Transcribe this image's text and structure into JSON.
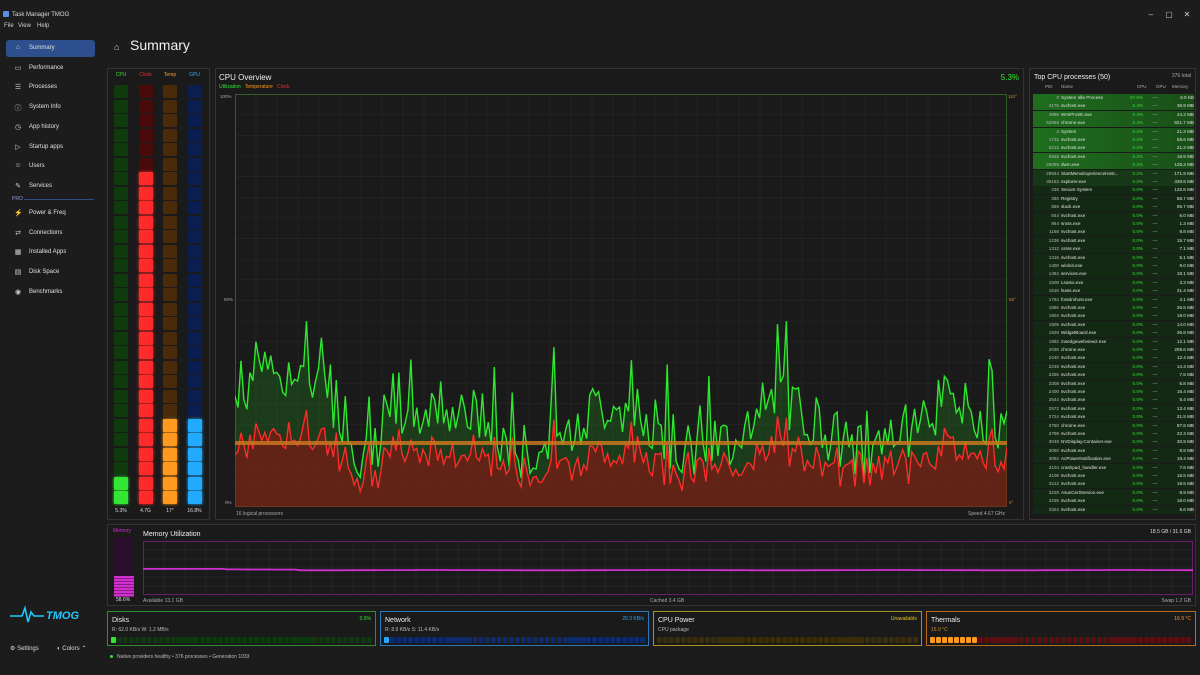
{
  "window": {
    "title": "Task Manager TMOG",
    "minimize": "–",
    "maximize": "▢",
    "close": "✕"
  },
  "menu": [
    "File",
    "View",
    "Help"
  ],
  "sidebar": {
    "items": [
      {
        "label": "Summary",
        "icon": "⌂",
        "active": true
      },
      {
        "label": "Performance",
        "icon": "▭"
      },
      {
        "label": "Processes",
        "icon": "☰"
      },
      {
        "label": "System Info",
        "icon": "ⓘ"
      },
      {
        "label": "App history",
        "icon": "◷"
      },
      {
        "label": "Startup apps",
        "icon": "▷"
      },
      {
        "label": "Users",
        "icon": "☺"
      },
      {
        "label": "Services",
        "icon": "✎"
      }
    ],
    "pro_label": "PRO",
    "pro_items": [
      {
        "label": "Power & Freq",
        "icon": "⚡"
      },
      {
        "label": "Connections",
        "icon": "⇄"
      },
      {
        "label": "Installed Apps",
        "icon": "▦"
      },
      {
        "label": "Disk Space",
        "icon": "▤"
      },
      {
        "label": "Benchmarks",
        "icon": "◉"
      }
    ],
    "logo_text": "TMOG",
    "settings_label": "Settings",
    "colors_label": "Colors"
  },
  "page": {
    "title": "Summary"
  },
  "bars": [
    {
      "label": "CPU",
      "value": "5.3%",
      "color": "#33e633",
      "level": 0.06
    },
    {
      "label": "Clock",
      "value": "4.7G",
      "color": "#ff2a2a",
      "level": 0.78
    },
    {
      "label": "Temp",
      "value": "17°",
      "color": "#ff9a1f",
      "level": 0.19
    },
    {
      "label": "GPU",
      "value": "16.8%",
      "color": "#22aaff",
      "level": 0.19
    }
  ],
  "cpu_overview": {
    "title": "CPU Overview",
    "percent": "5.3%",
    "legend": [
      "Utilization",
      "Temperature",
      "Clock"
    ],
    "legend_colors": [
      "#2ee82e",
      "#ff9a1f",
      "#ff2a2a"
    ],
    "left_axis": [
      "100%",
      "50%",
      "0%"
    ],
    "right_axis": [
      "110°",
      "55°",
      "0°"
    ],
    "logical": "16 logical processors",
    "speed": "Speed 4.67 GHz"
  },
  "processes": {
    "title": "Top CPU processes (50)",
    "total": "376 total",
    "headers": {
      "pid": "PID",
      "name": "Name",
      "cpu": "CPU",
      "gpu": "GPU",
      "memory": "Memory"
    },
    "rows": [
      [
        "0",
        "System Idle Process",
        "97.5%",
        "—",
        "8.0 KB"
      ],
      [
        "4176",
        "svchost.exe",
        "0.4%",
        "—",
        "36.9 MB"
      ],
      [
        "4996",
        "WmiPrvSE.exe",
        "0.4%",
        "—",
        "44.3 MB"
      ],
      [
        "52656",
        "chrome.exe",
        "0.4%",
        "—",
        "821.7 MB"
      ],
      [
        "4",
        "System",
        "0.2%",
        "—",
        "21.3 MB"
      ],
      [
        "1732",
        "svchost.exe",
        "0.2%",
        "—",
        "58.6 MB"
      ],
      [
        "5212",
        "svchost.exe",
        "0.2%",
        "—",
        "21.2 MB"
      ],
      [
        "6948",
        "svchost.exe",
        "0.2%",
        "—",
        "18.5 MB"
      ],
      [
        "28096",
        "dwm.exe",
        "0.2%",
        "—",
        "125.3 MB"
      ],
      [
        "29944",
        "StartMenuExperienceHost...",
        "0.2%",
        "—",
        "171.9 MB"
      ],
      [
        "36152",
        "explorer.exe",
        "0.2%",
        "—",
        "338.8 MB"
      ],
      [
        "236",
        "Secure System",
        "0.0%",
        "—",
        "132.8 MB"
      ],
      [
        "280",
        "Registry",
        "0.0%",
        "—",
        "56.7 MB"
      ],
      [
        "856",
        "slack.exe",
        "0.0%",
        "—",
        "95.7 MB"
      ],
      [
        "844",
        "svchost.exe",
        "0.0%",
        "—",
        "6.0 MB"
      ],
      [
        "864",
        "smss.exe",
        "0.0%",
        "—",
        "1.3 MB"
      ],
      [
        "1168",
        "svchost.exe",
        "0.0%",
        "—",
        "9.8 MB"
      ],
      [
        "1236",
        "svchost.exe",
        "0.0%",
        "—",
        "15.7 MB"
      ],
      [
        "1312",
        "csrss.exe",
        "0.0%",
        "—",
        "7.1 MB"
      ],
      [
        "1316",
        "svchost.exe",
        "0.0%",
        "—",
        "5.1 MB"
      ],
      [
        "1400",
        "wininit.exe",
        "0.0%",
        "—",
        "9.0 MB"
      ],
      [
        "1484",
        "services.exe",
        "0.0%",
        "—",
        "18.1 MB"
      ],
      [
        "1508",
        "LsaIso.exe",
        "0.0%",
        "—",
        "3.3 MB"
      ],
      [
        "1516",
        "lsass.exe",
        "0.0%",
        "—",
        "31.4 MB"
      ],
      [
        "1764",
        "fontdrvhost.exe",
        "0.0%",
        "—",
        "4.1 MB"
      ],
      [
        "1856",
        "svchost.exe",
        "0.0%",
        "—",
        "25.5 MB"
      ],
      [
        "1904",
        "svchost.exe",
        "0.0%",
        "—",
        "18.0 MB"
      ],
      [
        "1908",
        "svchost.exe",
        "0.0%",
        "—",
        "14.0 MB"
      ],
      [
        "1928",
        "WidgetBoard.exe",
        "0.0%",
        "—",
        "36.8 MB"
      ],
      [
        "1992",
        "msedgewebview2.exe",
        "0.0%",
        "—",
        "12.1 MB"
      ],
      [
        "2036",
        "chrome.exe",
        "0.0%",
        "—",
        "208.6 MB"
      ],
      [
        "2240",
        "svchost.exe",
        "0.0%",
        "—",
        "12.4 MB"
      ],
      [
        "2248",
        "svchost.exe",
        "0.0%",
        "—",
        "14.4 MB"
      ],
      [
        "2256",
        "svchost.exe",
        "0.0%",
        "—",
        "7.5 MB"
      ],
      [
        "2308",
        "svchost.exe",
        "0.0%",
        "—",
        "6.8 MB"
      ],
      [
        "2400",
        "svchost.exe",
        "0.0%",
        "—",
        "16.4 MB"
      ],
      [
        "2544",
        "svchost.exe",
        "0.0%",
        "—",
        "8.4 MB"
      ],
      [
        "2572",
        "svchost.exe",
        "0.0%",
        "—",
        "13.4 MB"
      ],
      [
        "2724",
        "svchost.exe",
        "0.0%",
        "—",
        "21.5 MB"
      ],
      [
        "2760",
        "chrome.exe",
        "0.0%",
        "—",
        "97.8 MB"
      ],
      [
        "2798",
        "svchost.exe",
        "0.0%",
        "—",
        "22.3 MB"
      ],
      [
        "3048",
        "NVDisplay.Container.exe",
        "0.0%",
        "—",
        "30.9 MB"
      ],
      [
        "3060",
        "svchost.exe",
        "0.0%",
        "—",
        "8.8 MB"
      ],
      [
        "3092",
        "AcPowerNotification.exe",
        "0.0%",
        "—",
        "19.4 MB"
      ],
      [
        "3104",
        "crashpad_handler.exe",
        "0.0%",
        "—",
        "7.6 MB"
      ],
      [
        "3108",
        "svchost.exe",
        "0.0%",
        "—",
        "15.5 MB"
      ],
      [
        "3212",
        "svchost.exe",
        "0.0%",
        "—",
        "19.5 MB"
      ],
      [
        "3228",
        "AsusCertService.exe",
        "0.0%",
        "—",
        "8.9 MB"
      ],
      [
        "3236",
        "svchost.exe",
        "0.0%",
        "—",
        "18.0 MB"
      ],
      [
        "3324",
        "svchost.exe",
        "0.0%",
        "—",
        "6.6 MB"
      ]
    ]
  },
  "memory": {
    "label": "Memory",
    "title": "Memory Utilization",
    "percent": "58.6%",
    "total": "18.5 GB / 31.6 GB",
    "available": "Available 13.1 GB",
    "cached": "Cached 3.4 GB",
    "swap": "Swap 1.2 GB",
    "color": "#d02fd0"
  },
  "cards": {
    "disks": {
      "title": "Disks",
      "sub": "R: 62.0 KB/s  W: 1.2 MB/s",
      "right": "0.6%",
      "color": "#2ee82e",
      "level": 0.02
    },
    "network": {
      "title": "Network",
      "sub": "R: 8.9 KB/s  S: 11.4 KB/s",
      "right": "20.3 KB/s",
      "color": "#22aaff",
      "level": 0.02
    },
    "cpu_power": {
      "title": "CPU Power",
      "sub": "CPU package",
      "right": "Unavailable",
      "color": "#e6c21f",
      "level": 0
    },
    "thermals": {
      "title": "Thermals",
      "sub": "16.9 °C",
      "right": "16.9 °C",
      "color": "#ff9a1f",
      "level": 0.19
    }
  },
  "status": {
    "text": "Native providers healthy  •  376 processes  •  Generation 1033"
  }
}
